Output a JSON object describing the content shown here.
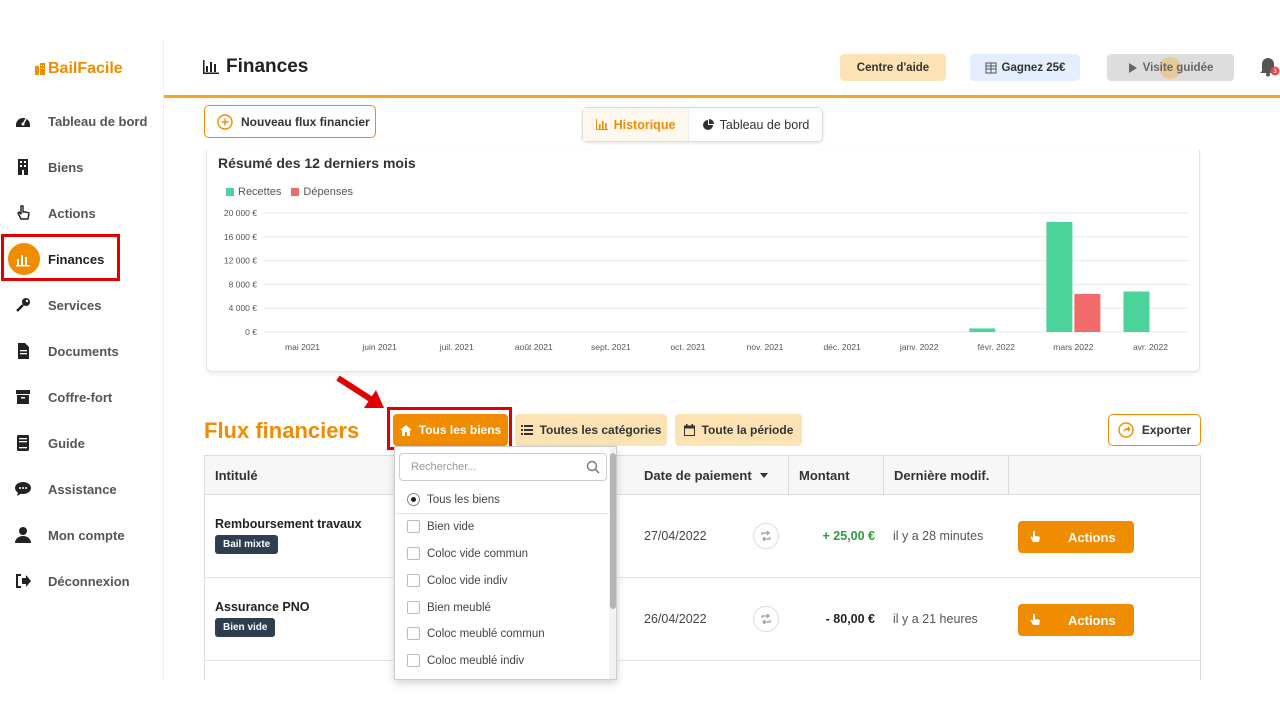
{
  "app": {
    "name": "BailFacile"
  },
  "sidebar": {
    "items": [
      {
        "label": "Tableau de bord",
        "icon": "dashboard-gauge-icon"
      },
      {
        "label": "Biens",
        "icon": "building-icon"
      },
      {
        "label": "Actions",
        "icon": "hand-pointer-icon"
      },
      {
        "label": "Finances",
        "icon": "bar-chart-icon",
        "active": true
      },
      {
        "label": "Services",
        "icon": "key-icon"
      },
      {
        "label": "Documents",
        "icon": "document-icon"
      },
      {
        "label": "Coffre-fort",
        "icon": "archive-box-icon"
      },
      {
        "label": "Guide",
        "icon": "book-icon"
      },
      {
        "label": "Assistance",
        "icon": "chat-bubble-icon"
      },
      {
        "label": "Mon compte",
        "icon": "user-icon"
      },
      {
        "label": "Déconnexion",
        "icon": "logout-icon"
      }
    ]
  },
  "header": {
    "title": "Finances",
    "help_label": "Centre d'aide",
    "gain_label": "Gagnez 25€",
    "tour_label": "Visite guidée",
    "notification_count": "3"
  },
  "toolbar": {
    "new_flux_label": "Nouveau flux financier",
    "tab_history": "Historique",
    "tab_dashboard": "Tableau de bord"
  },
  "chart_data": {
    "type": "bar",
    "title": "Résumé des 12 derniers mois",
    "categories": [
      "mai 2021",
      "juin 2021",
      "juil. 2021",
      "août 2021",
      "sept. 2021",
      "oct. 2021",
      "nov. 2021",
      "déc. 2021",
      "janv. 2022",
      "févr. 2022",
      "mars 2022",
      "avr. 2022"
    ],
    "series": [
      {
        "name": "Recettes",
        "color": "#4cd39b",
        "values": [
          0,
          0,
          0,
          0,
          0,
          0,
          0,
          0,
          0,
          600,
          18500,
          6800
        ]
      },
      {
        "name": "Dépenses",
        "color": "#f26b6b",
        "values": [
          0,
          0,
          0,
          0,
          0,
          0,
          0,
          0,
          0,
          0,
          6400,
          0
        ]
      }
    ],
    "yticks": [
      "20 000 €",
      "16 000 €",
      "12 000 €",
      "8 000 €",
      "4 000 €",
      "0 €"
    ],
    "ylim": [
      0,
      20000
    ],
    "grid": true,
    "legend": "top-left"
  },
  "flux": {
    "title": "Flux financiers",
    "filter_biens": "Tous les biens",
    "filter_categories": "Toutes les catégories",
    "filter_period": "Toute la période",
    "export_label": "Exporter"
  },
  "table": {
    "columns": [
      "Intitulé",
      "Date de paiement",
      "Montant",
      "Dernière modif."
    ],
    "rows": [
      {
        "title": "Remboursement travaux",
        "badge": "Bail mixte",
        "date": "27/04/2022",
        "amount": "+ 25,00 €",
        "amount_color": "#2e9d3a",
        "modified": "il y a 28 minutes",
        "action": "Actions"
      },
      {
        "title": "Assurance PNO",
        "badge": "Bien vide",
        "date": "26/04/2022",
        "amount": "- 80,00 €",
        "amount_color": "#222222",
        "modified": "il y a 21 heures",
        "action": "Actions"
      }
    ]
  },
  "dropdown": {
    "placeholder": "Rechercher...",
    "options": [
      {
        "label": "Tous les biens",
        "selected": true
      },
      {
        "label": "Bien vide"
      },
      {
        "label": "Coloc vide commun"
      },
      {
        "label": "Coloc vide indiv"
      },
      {
        "label": "Bien meublé"
      },
      {
        "label": "Coloc meublé commun"
      },
      {
        "label": "Coloc meublé indiv"
      }
    ]
  },
  "colors": {
    "accent": "#f08c00",
    "highlight": "#e00000"
  }
}
